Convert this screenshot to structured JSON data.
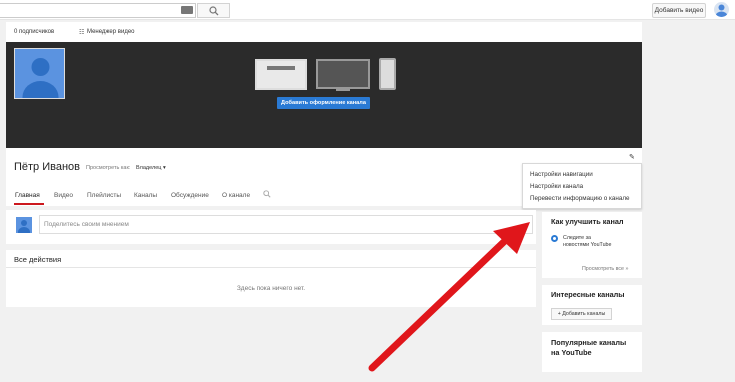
{
  "header": {
    "upload_label": "Добавить видео"
  },
  "channel": {
    "subscribers": "0 подписчиков",
    "video_manager": "Менеджер видео",
    "banner_button": "Добавить оформление канала",
    "name": "Пётр Иванов",
    "view_as_label": "Просмотреть как:",
    "view_as_value": "Владелец ▾"
  },
  "tabs": [
    {
      "label": "Главная",
      "active": true
    },
    {
      "label": "Видео"
    },
    {
      "label": "Плейлисты"
    },
    {
      "label": "Каналы"
    },
    {
      "label": "Обсуждение"
    },
    {
      "label": "О канале"
    }
  ],
  "dropdown": {
    "items": [
      "Настройки навигации",
      "Настройки канала",
      "Перевести информацию о канале"
    ]
  },
  "share": {
    "placeholder": "Поделитесь своим мнением"
  },
  "activity": {
    "title": "Все действия",
    "empty": "Здесь пока ничего нет."
  },
  "sidebar": {
    "improve_title": "Как улучшить канал",
    "improve_tip": "Следите за новостями YouTube",
    "view_all": "Просмотреть все »",
    "interesting_title": "Интересные каналы",
    "add_channels": "+ Добавить каналы",
    "popular_title": "Популярные каналы на YouTube"
  },
  "colors": {
    "accent": "#2a7ad4",
    "tab_underline": "#cc181e",
    "arrow": "#e0161b"
  }
}
